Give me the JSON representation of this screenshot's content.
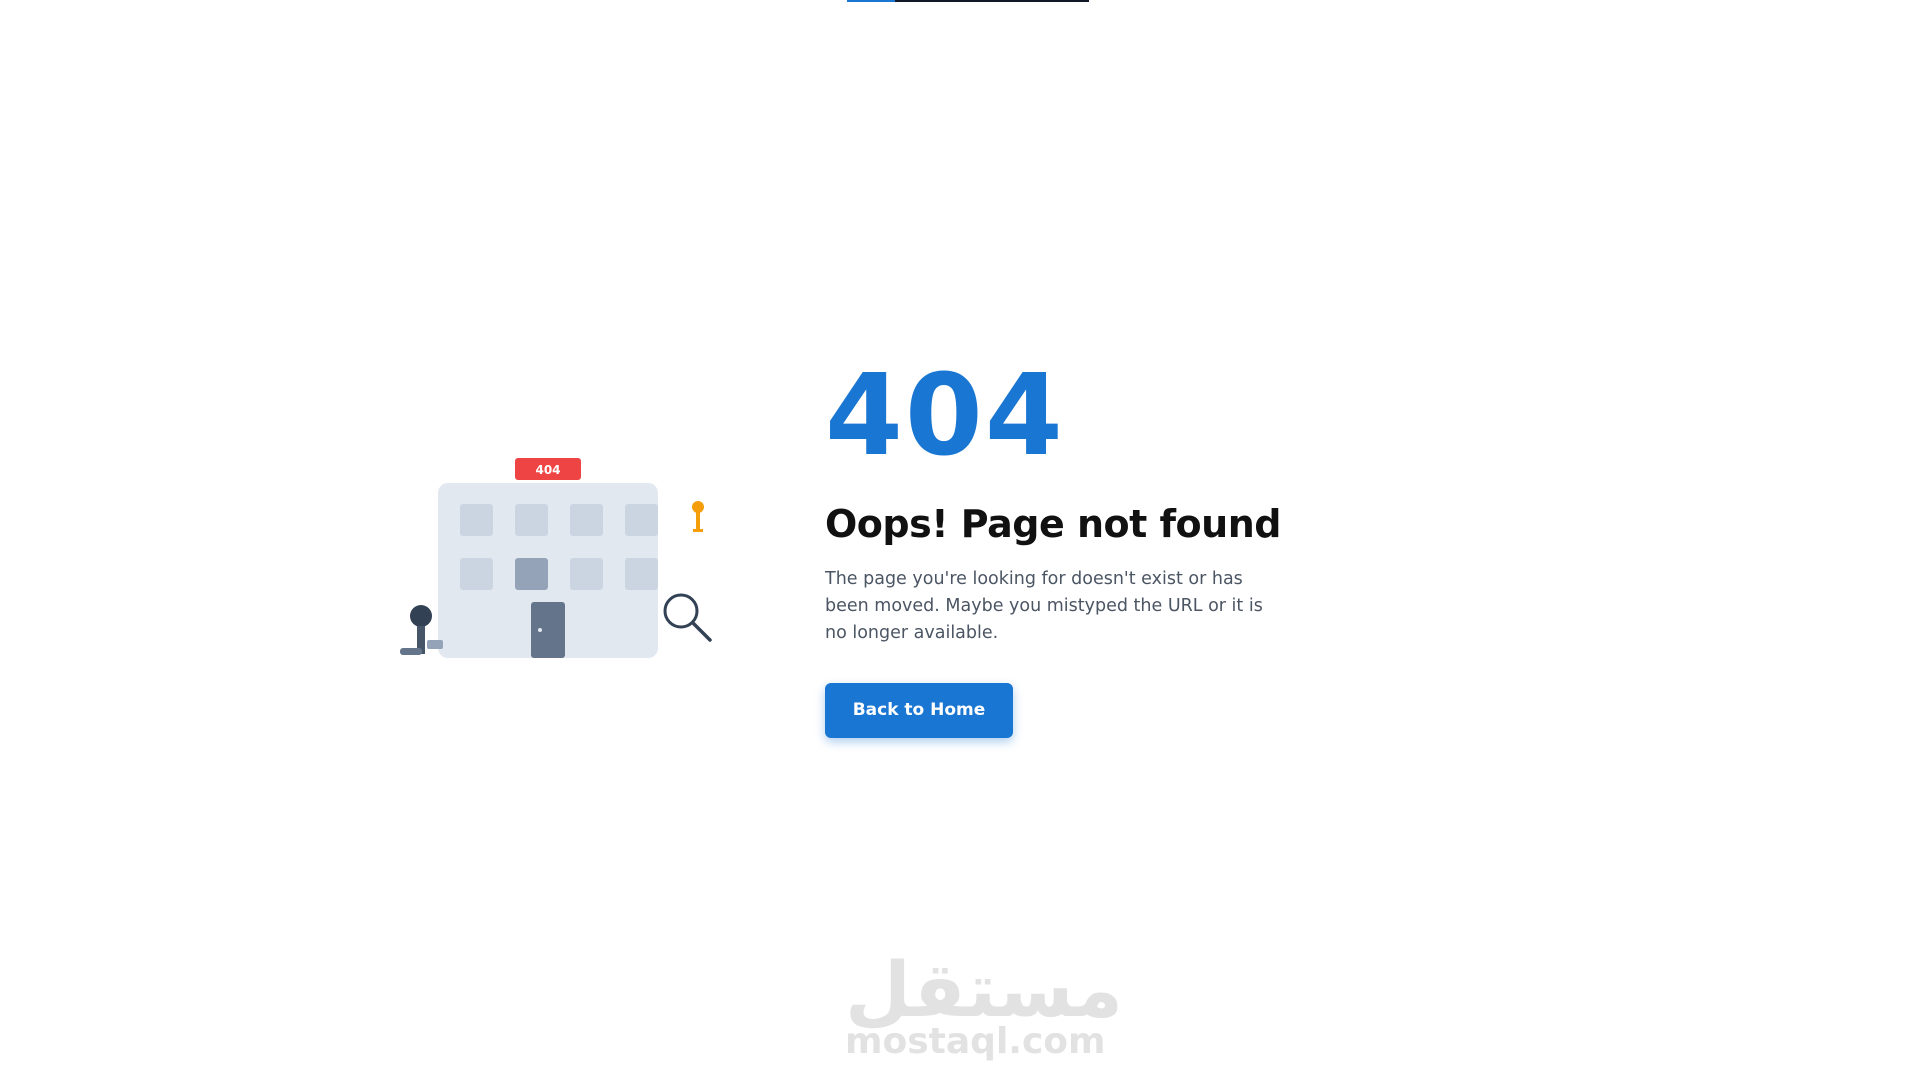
{
  "colors": {
    "accent": "#1976d2",
    "badge": "#ef4444",
    "building": "#e2e8f0",
    "window": "#cbd5e1",
    "window_dark": "#94a3b8",
    "door": "#64748b",
    "key": "#f59e0b",
    "figure": "#334155",
    "watermark": "#e2e2e2"
  },
  "illustration": {
    "badge_text": "404",
    "icons": [
      "building-icon",
      "key-icon",
      "magnifier-icon",
      "person-icon"
    ]
  },
  "error": {
    "code": "404",
    "headline": "Oops! Page not found",
    "message": "The page you're looking for doesn't exist or has been moved. Maybe you mistyped the URL or it is no longer available."
  },
  "actions": {
    "home_label": "Back to Home"
  },
  "watermark": {
    "arabic": "مستقل",
    "latin": "mostaql.com"
  }
}
